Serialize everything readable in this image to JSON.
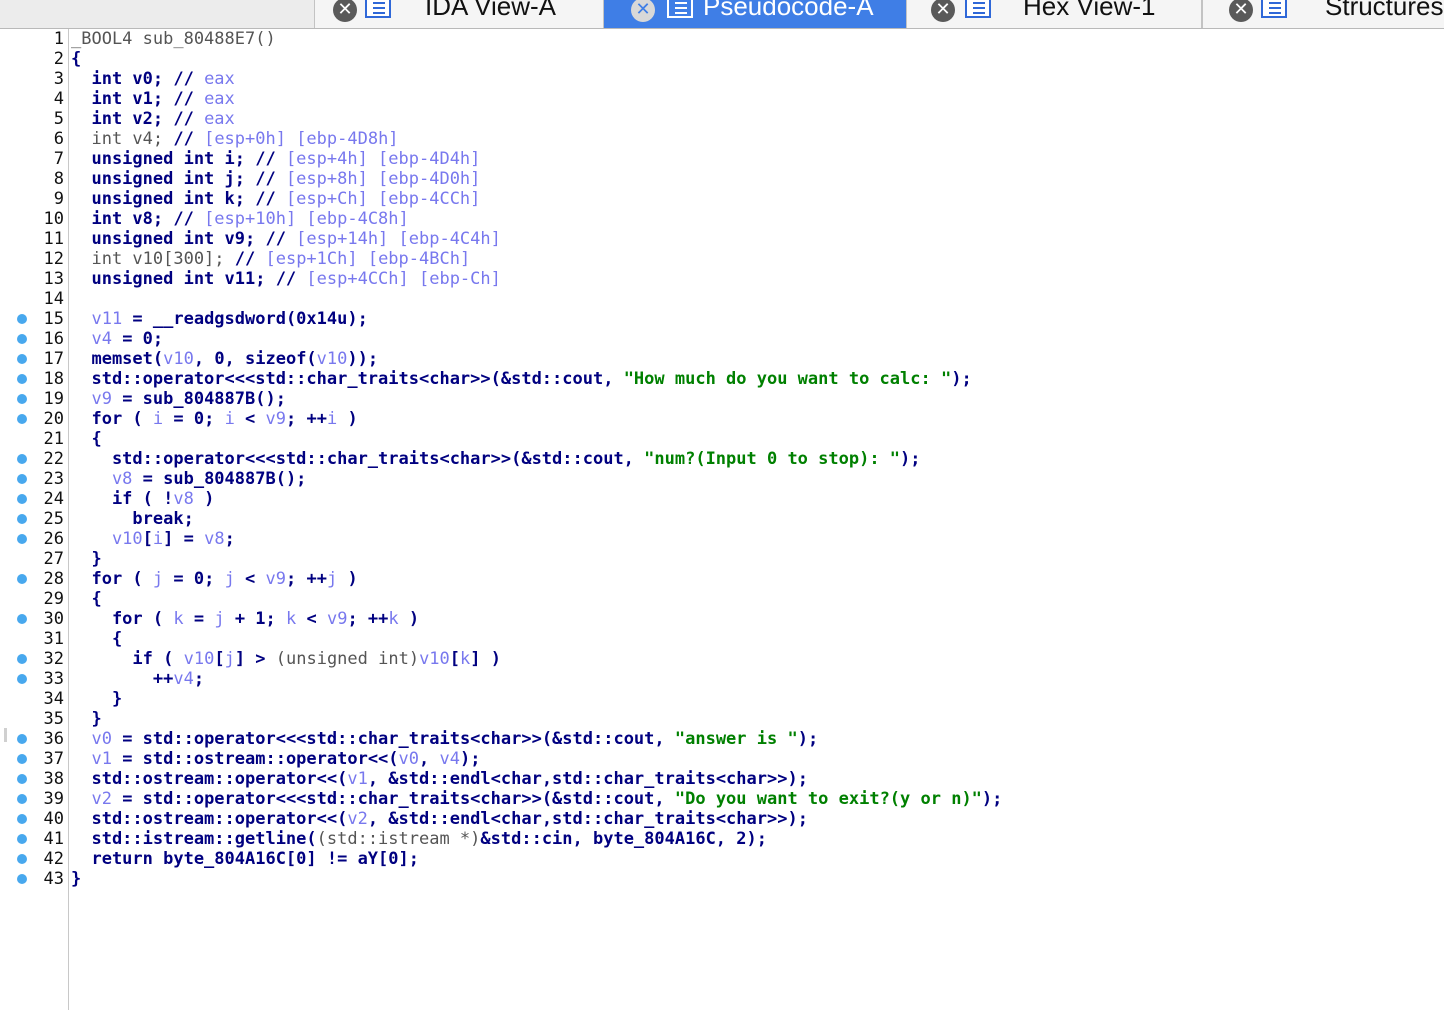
{
  "tabs": [
    {
      "label": "IDA View-A",
      "active": false,
      "icon": "list-view-icon"
    },
    {
      "label": "Pseudocode-A",
      "active": true,
      "icon": "pseudocode-icon"
    },
    {
      "label": "Hex View-1",
      "active": false,
      "icon": "hex-view-icon"
    },
    {
      "label": "Structures",
      "active": false,
      "icon": "structures-icon"
    }
  ],
  "close_glyph": "✕",
  "code_lines": [
    {
      "n": "1",
      "bp": false,
      "segs": [
        [
          "d",
          "_BOOL4 sub_80488E7()"
        ]
      ]
    },
    {
      "n": "2",
      "bp": false,
      "segs": [
        [
          "k",
          "{"
        ]
      ]
    },
    {
      "n": "3",
      "bp": false,
      "segs": [
        [
          "k",
          "  int v0; // "
        ],
        [
          "g",
          "eax"
        ]
      ]
    },
    {
      "n": "4",
      "bp": false,
      "segs": [
        [
          "k",
          "  int v1; // "
        ],
        [
          "g",
          "eax"
        ]
      ]
    },
    {
      "n": "5",
      "bp": false,
      "segs": [
        [
          "k",
          "  int v2; // "
        ],
        [
          "g",
          "eax"
        ]
      ]
    },
    {
      "n": "6",
      "bp": false,
      "segs": [
        [
          "d",
          "  int v4; "
        ],
        [
          "k",
          "// "
        ],
        [
          "g",
          "[esp+0h] [ebp-4D8h]"
        ]
      ]
    },
    {
      "n": "7",
      "bp": false,
      "segs": [
        [
          "k",
          "  unsigned int i; // "
        ],
        [
          "g",
          "[esp+4h] [ebp-4D4h]"
        ]
      ]
    },
    {
      "n": "8",
      "bp": false,
      "segs": [
        [
          "k",
          "  unsigned int j; // "
        ],
        [
          "g",
          "[esp+8h] [ebp-4D0h]"
        ]
      ]
    },
    {
      "n": "9",
      "bp": false,
      "segs": [
        [
          "k",
          "  unsigned int k; // "
        ],
        [
          "g",
          "[esp+Ch] [ebp-4CCh]"
        ]
      ]
    },
    {
      "n": "10",
      "bp": false,
      "segs": [
        [
          "k",
          "  int v8; // "
        ],
        [
          "g",
          "[esp+10h] [ebp-4C8h]"
        ]
      ]
    },
    {
      "n": "11",
      "bp": false,
      "segs": [
        [
          "k",
          "  unsigned int v9; // "
        ],
        [
          "g",
          "[esp+14h] [ebp-4C4h]"
        ]
      ]
    },
    {
      "n": "12",
      "bp": false,
      "segs": [
        [
          "d",
          "  int v10[300]; "
        ],
        [
          "k",
          "// "
        ],
        [
          "g",
          "[esp+1Ch] [ebp-4BCh]"
        ]
      ]
    },
    {
      "n": "13",
      "bp": false,
      "segs": [
        [
          "k",
          "  unsigned int v11; // "
        ],
        [
          "g",
          "[esp+4CCh] [ebp-Ch]"
        ]
      ]
    },
    {
      "n": "14",
      "bp": false,
      "segs": [
        [
          "k",
          ""
        ]
      ]
    },
    {
      "n": "15",
      "bp": true,
      "segs": [
        [
          "v",
          "  v11"
        ],
        [
          "k",
          " = __readgsdword(0x14u);"
        ]
      ]
    },
    {
      "n": "16",
      "bp": true,
      "segs": [
        [
          "v",
          "  v4"
        ],
        [
          "k",
          " = 0;"
        ]
      ]
    },
    {
      "n": "17",
      "bp": true,
      "segs": [
        [
          "k",
          "  memset("
        ],
        [
          "v",
          "v10"
        ],
        [
          "k",
          ", 0, sizeof("
        ],
        [
          "v",
          "v10"
        ],
        [
          "k",
          "));"
        ]
      ]
    },
    {
      "n": "18",
      "bp": true,
      "segs": [
        [
          "k",
          "  std::operator<<<std::char_traits<char>>(&std::cout, "
        ],
        [
          "s",
          "\"How much do you want to calc: \""
        ],
        [
          "k",
          ");"
        ]
      ]
    },
    {
      "n": "19",
      "bp": true,
      "segs": [
        [
          "v",
          "  v9"
        ],
        [
          "k",
          " = sub_804887B();"
        ]
      ]
    },
    {
      "n": "20",
      "bp": true,
      "segs": [
        [
          "k",
          "  for ( "
        ],
        [
          "v",
          "i"
        ],
        [
          "k",
          " = 0; "
        ],
        [
          "v",
          "i"
        ],
        [
          "k",
          " < "
        ],
        [
          "v",
          "v9"
        ],
        [
          "k",
          "; ++"
        ],
        [
          "v",
          "i"
        ],
        [
          "k",
          " )"
        ]
      ]
    },
    {
      "n": "21",
      "bp": false,
      "segs": [
        [
          "k",
          "  {"
        ]
      ]
    },
    {
      "n": "22",
      "bp": true,
      "segs": [
        [
          "k",
          "    std::operator<<<std::char_traits<char>>(&std::cout, "
        ],
        [
          "s",
          "\"num?(Input 0 to stop): \""
        ],
        [
          "k",
          ");"
        ]
      ]
    },
    {
      "n": "23",
      "bp": true,
      "segs": [
        [
          "v",
          "    v8"
        ],
        [
          "k",
          " = sub_804887B();"
        ]
      ]
    },
    {
      "n": "24",
      "bp": true,
      "segs": [
        [
          "k",
          "    if ( !"
        ],
        [
          "v",
          "v8"
        ],
        [
          "k",
          " )"
        ]
      ]
    },
    {
      "n": "25",
      "bp": true,
      "segs": [
        [
          "k",
          "      break;"
        ]
      ]
    },
    {
      "n": "26",
      "bp": true,
      "segs": [
        [
          "v",
          "    v10"
        ],
        [
          "k",
          "["
        ],
        [
          "v",
          "i"
        ],
        [
          "k",
          "] = "
        ],
        [
          "v",
          "v8"
        ],
        [
          "k",
          ";"
        ]
      ]
    },
    {
      "n": "27",
      "bp": false,
      "segs": [
        [
          "k",
          "  }"
        ]
      ]
    },
    {
      "n": "28",
      "bp": true,
      "segs": [
        [
          "k",
          "  for ( "
        ],
        [
          "v",
          "j"
        ],
        [
          "k",
          " = 0; "
        ],
        [
          "v",
          "j"
        ],
        [
          "k",
          " < "
        ],
        [
          "v",
          "v9"
        ],
        [
          "k",
          "; ++"
        ],
        [
          "v",
          "j"
        ],
        [
          "k",
          " )"
        ]
      ]
    },
    {
      "n": "29",
      "bp": false,
      "segs": [
        [
          "k",
          "  {"
        ]
      ]
    },
    {
      "n": "30",
      "bp": true,
      "segs": [
        [
          "k",
          "    for ( "
        ],
        [
          "v",
          "k"
        ],
        [
          "k",
          " = "
        ],
        [
          "v",
          "j"
        ],
        [
          "k",
          " + 1; "
        ],
        [
          "v",
          "k"
        ],
        [
          "k",
          " < "
        ],
        [
          "v",
          "v9"
        ],
        [
          "k",
          "; ++"
        ],
        [
          "v",
          "k"
        ],
        [
          "k",
          " )"
        ]
      ]
    },
    {
      "n": "31",
      "bp": false,
      "segs": [
        [
          "k",
          "    {"
        ]
      ]
    },
    {
      "n": "32",
      "bp": true,
      "segs": [
        [
          "k",
          "      if ( "
        ],
        [
          "v",
          "v10"
        ],
        [
          "k",
          "["
        ],
        [
          "v",
          "j"
        ],
        [
          "k",
          "] > "
        ],
        [
          "d",
          "(unsigned int)"
        ],
        [
          "v",
          "v10"
        ],
        [
          "k",
          "["
        ],
        [
          "v",
          "k"
        ],
        [
          "k",
          "] )"
        ]
      ]
    },
    {
      "n": "33",
      "bp": true,
      "segs": [
        [
          "k",
          "        ++"
        ],
        [
          "v",
          "v4"
        ],
        [
          "k",
          ";"
        ]
      ]
    },
    {
      "n": "34",
      "bp": false,
      "segs": [
        [
          "k",
          "    }"
        ]
      ]
    },
    {
      "n": "35",
      "bp": false,
      "segs": [
        [
          "k",
          "  }"
        ]
      ]
    },
    {
      "n": "36",
      "bp": true,
      "segs": [
        [
          "v",
          "  v0"
        ],
        [
          "k",
          " = std::operator<<<std::char_traits<char>>(&std::cout, "
        ],
        [
          "s",
          "\"answer is \""
        ],
        [
          "k",
          ");"
        ]
      ]
    },
    {
      "n": "37",
      "bp": true,
      "segs": [
        [
          "v",
          "  v1"
        ],
        [
          "k",
          " = std::ostream::operator<<("
        ],
        [
          "v",
          "v0"
        ],
        [
          "k",
          ", "
        ],
        [
          "v",
          "v4"
        ],
        [
          "k",
          ");"
        ]
      ]
    },
    {
      "n": "38",
      "bp": true,
      "segs": [
        [
          "k",
          "  std::ostream::operator<<("
        ],
        [
          "v",
          "v1"
        ],
        [
          "k",
          ", &std::endl<char,std::char_traits<char>>);"
        ]
      ]
    },
    {
      "n": "39",
      "bp": true,
      "segs": [
        [
          "v",
          "  v2"
        ],
        [
          "k",
          " = std::operator<<<std::char_traits<char>>(&std::cout, "
        ],
        [
          "s",
          "\"Do you want to exit?(y or n)\""
        ],
        [
          "k",
          ");"
        ]
      ]
    },
    {
      "n": "40",
      "bp": true,
      "segs": [
        [
          "k",
          "  std::ostream::operator<<("
        ],
        [
          "v",
          "v2"
        ],
        [
          "k",
          ", &std::endl<char,std::char_traits<char>>);"
        ]
      ]
    },
    {
      "n": "41",
      "bp": true,
      "segs": [
        [
          "k",
          "  std::istream::getline("
        ],
        [
          "d",
          "(std::istream *)"
        ],
        [
          "k",
          "&std::cin, byte_804A16C, 2);"
        ]
      ]
    },
    {
      "n": "42",
      "bp": true,
      "segs": [
        [
          "k",
          "  return byte_804A16C[0] != aY[0];"
        ]
      ]
    },
    {
      "n": "43",
      "bp": true,
      "segs": [
        [
          "k",
          "}"
        ]
      ]
    }
  ]
}
